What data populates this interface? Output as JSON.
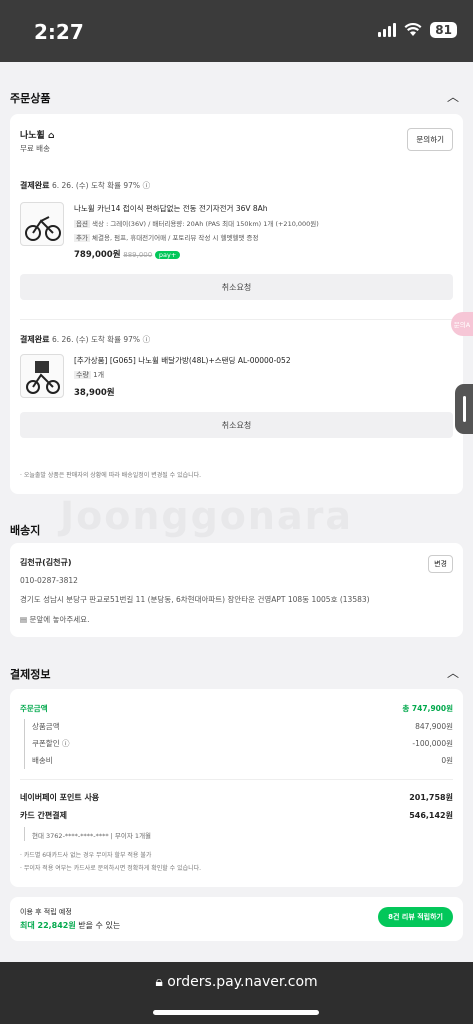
{
  "status": {
    "time": "2:27",
    "battery": "81"
  },
  "order_section": {
    "title": "주문상품"
  },
  "seller": {
    "name": "나노휠",
    "shipping": "무료 배송",
    "inquiry_label": "문의하기"
  },
  "items": [
    {
      "status": "결제완료",
      "arrival": "6. 26. (수) 도착 확률 97%",
      "name": "나노휠 카닌14 접이식 편하답없는 전동 전기자전거 36V 8Ah",
      "option_tag": "옵션",
      "option": "색상 : 그레이(36V) / 배터리용량: 20Ah (PAS 최대 150km)",
      "qty": "1개 (+210,000원)",
      "option_tag2": "추가",
      "option2": "체결용, 펌프, 휴대전기어매 / 포토리뷰 작성 시 헬멧헬맷 증정",
      "price": "789,000원",
      "original_price": "889,000",
      "pay_badge": "pay+",
      "cancel_label": "취소요청"
    },
    {
      "status": "결제완료",
      "arrival": "6. 26. (수) 도착 확률 97%",
      "name": "[추가상품] [G065] 나노휠 배달가방(48L)+스탠딩 AL-00000-052",
      "qty_tag": "수량",
      "qty": "1개",
      "price": "38,900원",
      "cancel_label": "취소요청"
    }
  ],
  "notice": "오늘출발 상품은 판매자의 상황에 따라 배송일정이 변경될 수 있습니다.",
  "watermark": "Joonggonara",
  "delivery": {
    "title": "배송지",
    "name": "김천규(김천규)",
    "phone": "010-0287-3812",
    "address": "경기도 성남시 분당구 판교로51번길 11 (분당동, 6차현대아파트) 장안타운 건영APT 108동 1005호 (13583)",
    "memo": "문앞에 놓아주세요.",
    "change_label": "변경"
  },
  "payment": {
    "title": "결제정보",
    "total_label": "주문금액",
    "total_value": "총 747,900원",
    "rows": [
      {
        "label": "상품금액",
        "value": "847,900원"
      },
      {
        "label": "쿠폰할인",
        "value": "-100,000원"
      },
      {
        "label": "배송비",
        "value": "0원"
      }
    ],
    "point_label": "네이버페이 포인트 사용",
    "point_value": "201,758원",
    "card_label": "카드 간편결제",
    "card_value": "546,142원",
    "card_info": "현대 3762-****-****-**** | 무이자 1개월",
    "notes": [
      "카드별 6대카드사 없는 경우 무이자 할부 적용 불가",
      "무이자 적용 여부는 카드사로 문의하시면 정확하게 확인할 수 있습니다."
    ]
  },
  "reward": {
    "line1": "이용 후 적립 예정",
    "line2_amount": "최대 22,842원",
    "line2_rest": " 받을 수 있는",
    "button": "8건 리뷰 적립하기"
  },
  "floating_badge": "문의A",
  "browser": {
    "url": "orders.pay.naver.com"
  },
  "colors": {
    "accent": "#03a94d",
    "badge": "#f6c6d6"
  }
}
